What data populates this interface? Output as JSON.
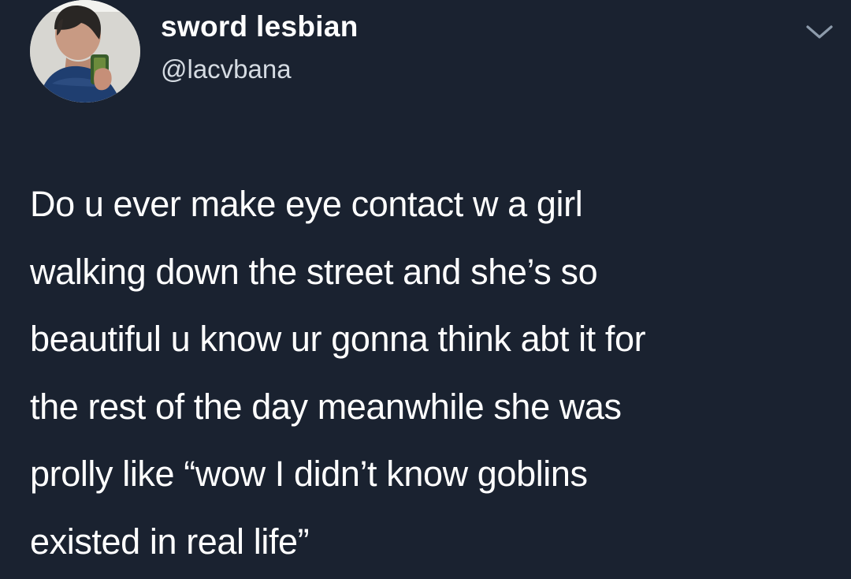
{
  "theme": {
    "background": "#1a2230",
    "text": "#ffffff",
    "muted_text": "#d5dbe2"
  },
  "tweet": {
    "author": {
      "display_name": "sword lesbian",
      "handle": "@lacvbana"
    },
    "text_lines": [
      "Do u ever make eye contact w a girl",
      "walking down the street and she’s so",
      "beautiful u know ur gonna think abt it for",
      "the rest of the day meanwhile she was",
      "prolly like “wow I didn’t know goblins",
      "existed in real life”"
    ],
    "menu_icon": "chevron-down-icon"
  }
}
